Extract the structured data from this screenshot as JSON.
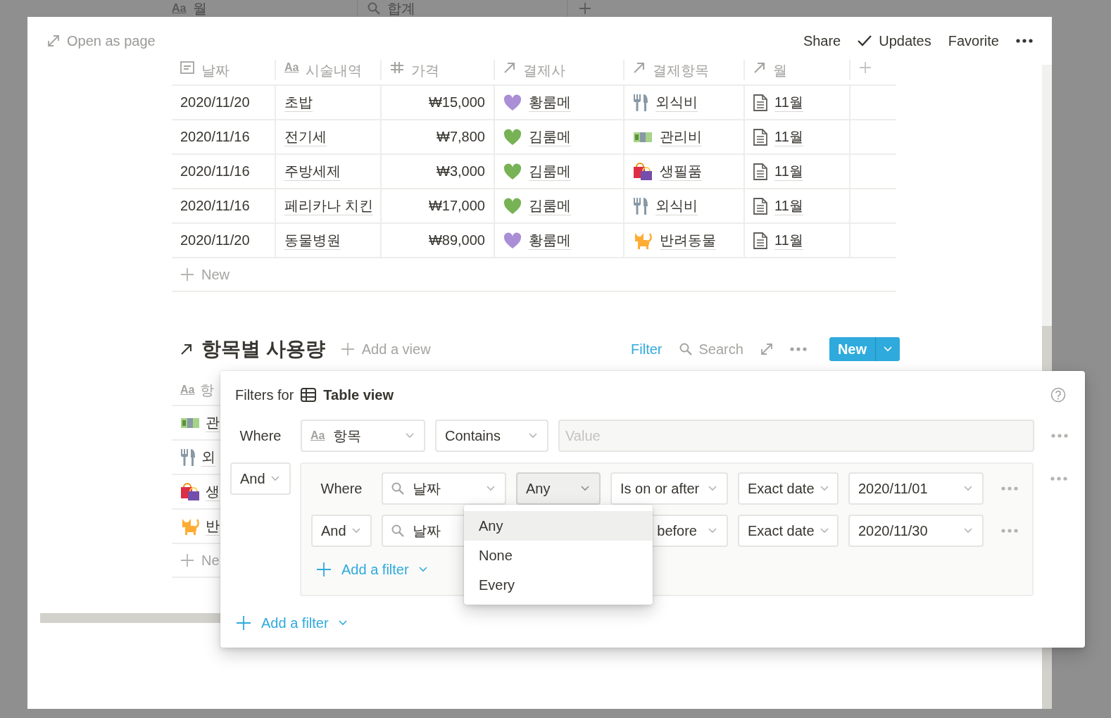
{
  "background_table": {
    "columns": [
      {
        "kind": "title",
        "type_label": "Aa",
        "label": "월"
      },
      {
        "kind": "search",
        "label": "합계"
      }
    ]
  },
  "top_bar": {
    "open_as_page": "Open as page",
    "actions": [
      {
        "kind": "text",
        "label": "Share"
      },
      {
        "kind": "check",
        "label": "Updates"
      },
      {
        "kind": "text",
        "label": "Favorite"
      },
      {
        "kind": "more"
      }
    ]
  },
  "table": {
    "columns": [
      {
        "kind": "date",
        "label": "날짜"
      },
      {
        "kind": "title",
        "type_label": "Aa",
        "label": "시술내역"
      },
      {
        "kind": "number",
        "label": "가격"
      },
      {
        "kind": "relation",
        "label": "결제사"
      },
      {
        "kind": "relation",
        "label": "결제항목"
      },
      {
        "kind": "relation",
        "label": "월"
      },
      {
        "kind": "add"
      }
    ],
    "rows": [
      {
        "date": "2020/11/20",
        "treatment": "초밥",
        "price": "₩15,000",
        "payer": {
          "label": "황룸메",
          "color": "#aa8ed6"
        },
        "category": {
          "label": "외식비",
          "kind": "dining"
        },
        "month": "11월"
      },
      {
        "date": "2020/11/16",
        "treatment": "전기세",
        "price": "₩7,800",
        "payer": {
          "label": "김룸메",
          "color": "#77b255"
        },
        "category": {
          "label": "관리비",
          "kind": "utility"
        },
        "month": "11월"
      },
      {
        "date": "2020/11/16",
        "treatment": "주방세제",
        "price": "₩3,000",
        "payer": {
          "label": "김룸메",
          "color": "#77b255"
        },
        "category": {
          "label": "생필품",
          "kind": "supplies"
        },
        "month": "11월"
      },
      {
        "date": "2020/11/16",
        "treatment": "페리카나 치킨",
        "price": "₩17,000",
        "payer": {
          "label": "김룸메",
          "color": "#77b255"
        },
        "category": {
          "label": "외식비",
          "kind": "dining"
        },
        "month": "11월"
      },
      {
        "date": "2020/11/20",
        "treatment": "동물병원",
        "price": "₩89,000",
        "payer": {
          "label": "황룸메",
          "color": "#aa8ed6"
        },
        "category": {
          "label": "반려동물",
          "kind": "pet"
        },
        "month": "11월"
      }
    ],
    "new_row": "New"
  },
  "section": {
    "title": "항목별 사용량",
    "add_view": "Add a view",
    "filter": "Filter",
    "search": "Search",
    "new": "New",
    "table": {
      "column": {
        "kind": "title",
        "type_label": "Aa",
        "label": "항"
      },
      "rows": [
        {
          "kind": "utility",
          "label": "관"
        },
        {
          "kind": "dining",
          "label": "외"
        },
        {
          "kind": "supplies",
          "label": "생"
        },
        {
          "kind": "pet",
          "label": "반"
        }
      ],
      "new_row": "Ne"
    }
  },
  "filter_popup": {
    "title_prefix": "Filters for",
    "view_name": "Table view",
    "rule": {
      "conjunction": {
        "kind": "label",
        "label": "Where"
      },
      "property": {
        "kind": "title",
        "type_label": "Aa",
        "label": "항목"
      },
      "operator": "Contains",
      "value": {
        "placeholder": "Value"
      }
    },
    "group": {
      "conjunction": {
        "kind": "select",
        "label": "And"
      },
      "rules": [
        {
          "conjunction": {
            "kind": "label",
            "label": "Where"
          },
          "property": {
            "kind": "search",
            "label": "날짜"
          },
          "quantifier": {
            "label": "Any",
            "open": true
          },
          "operator": "Is on or after",
          "date_mode": "Exact date",
          "date": "2020/11/01"
        },
        {
          "conjunction": {
            "kind": "select",
            "label": "And"
          },
          "property": {
            "kind": "search",
            "label": "날짜"
          },
          "operator": "before",
          "date_mode": "Exact date",
          "date": "2020/11/30"
        }
      ],
      "add_filter": "Add a filter"
    },
    "add_filter": "Add a filter",
    "menu": {
      "items": [
        {
          "label": "Any",
          "selected": true
        },
        {
          "label": "None",
          "selected": false
        },
        {
          "label": "Every",
          "selected": false
        }
      ]
    }
  }
}
